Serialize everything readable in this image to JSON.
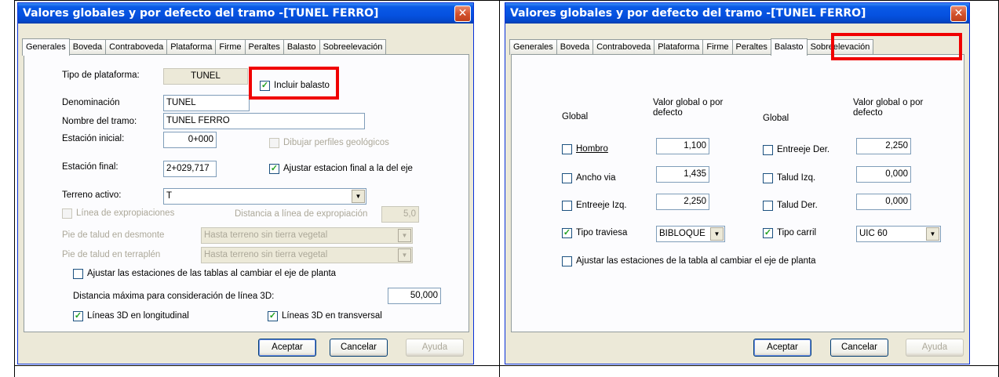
{
  "window_title": "Valores globales y por defecto del tramo -[TUNEL FERRO]",
  "close_glyph": "✕",
  "tabs": [
    "Generales",
    "Boveda",
    "Contraboveda",
    "Plataforma",
    "Firme",
    "Peraltes",
    "Balasto",
    "Sobreelevación"
  ],
  "left": {
    "active_tab": "Generales",
    "tipo_plataforma_label": "Tipo de plataforma:",
    "tipo_plataforma_value": "TUNEL",
    "incluir_balasto_label": "Incluir balasto",
    "incluir_balasto_checked": true,
    "denominacion_label": "Denominación",
    "denominacion_value": "TUNEL",
    "nombre_tramo_label": "Nombre del tramo:",
    "nombre_tramo_value": "TUNEL FERRO",
    "estacion_inicial_label": "Estación inicial:",
    "estacion_inicial_value": "0+000",
    "dibujar_perfiles_label": "Dibujar perfiles geológicos",
    "estacion_final_label": "Estación final:",
    "estacion_final_value": "2+029,717",
    "ajustar_final_label": "Ajustar estacion final a la del eje",
    "ajustar_final_checked": true,
    "terreno_activo_label": "Terreno activo:",
    "terreno_activo_value": "T",
    "linea_expropiaciones_label": "Línea de expropiaciones",
    "distancia_expropiacion_label": "Distancia a línea de expropiación",
    "distancia_expropiacion_value": "5,0",
    "pie_desmonte_label": "Pie de talud en desmonte",
    "pie_desmonte_value": "Hasta terreno sin tierra vegetal",
    "pie_terraplen_label": "Pie de talud en terraplén",
    "pie_terraplen_value": "Hasta terreno sin tierra vegetal",
    "ajustar_tablas_label": "Ajustar las estaciones de las tablas al cambiar el eje de planta",
    "distancia_3d_label": "Distancia máxima para consideración de línea 3D:",
    "distancia_3d_value": "50,000",
    "lineas_long_label": "Líneas 3D en longitudinal",
    "lineas_trans_label": "Líneas 3D en transversal"
  },
  "right": {
    "active_tab": "Balasto",
    "global_header": "Global",
    "valor_header_1": "Valor global o por",
    "valor_header_2": "defecto",
    "hombro_label": "Hombro",
    "hombro_value": "1,100",
    "ancho_via_label": "Ancho via",
    "ancho_via_value": "1,435",
    "entreeje_izq_label": "Entreeje Izq.",
    "entreeje_izq_value": "2,250",
    "tipo_traviesa_label": "Tipo traviesa",
    "tipo_traviesa_value": "BIBLOQUE",
    "entreeje_der_label": "Entreeje Der.",
    "entreeje_der_value": "2,250",
    "talud_izq_label": "Talud Izq.",
    "talud_izq_value": "0,000",
    "talud_der_label": "Talud Der.",
    "talud_der_value": "0,000",
    "tipo_carril_label": "Tipo carril",
    "tipo_carril_value": "UIC 60",
    "ajustar_tabla_label": "Ajustar las estaciones de la tabla al cambiar el eje de planta"
  },
  "buttons": {
    "aceptar": "Aceptar",
    "cancelar": "Cancelar",
    "ayuda": "Ayuda"
  },
  "glyphs": {
    "check": "✓",
    "dropdown_arrow": "▼"
  },
  "colors": {
    "highlight": "#f00000",
    "titlebar": "#0551e0",
    "dialog_bg": "#ece9d8"
  }
}
